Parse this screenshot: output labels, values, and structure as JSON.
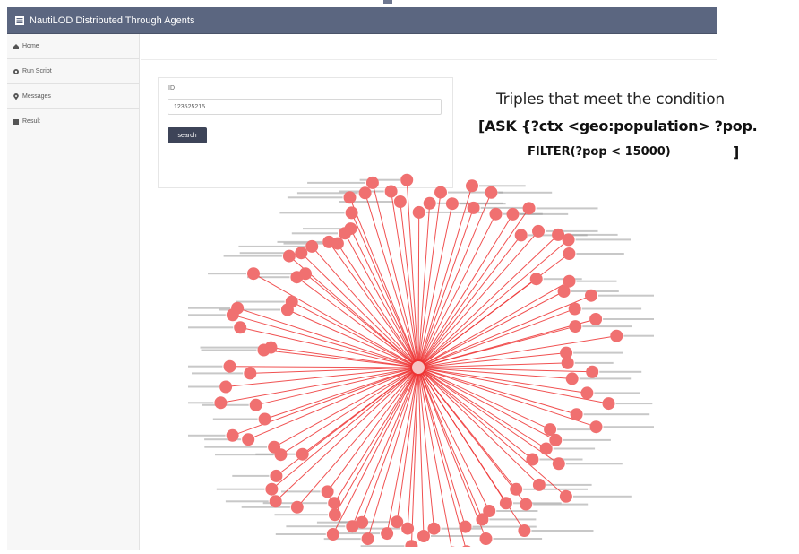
{
  "app": {
    "title": "NautiLOD Distributed Through Agents"
  },
  "sidebar": {
    "items": [
      {
        "label": "Home",
        "icon": "home-icon"
      },
      {
        "label": "Run Script",
        "icon": "gear-icon"
      },
      {
        "label": "Messages",
        "icon": "map-marker-icon"
      },
      {
        "label": "Result",
        "icon": "result-icon"
      }
    ]
  },
  "search": {
    "label": "ID",
    "value": "123525215",
    "button_label": "search"
  },
  "annotation": {
    "line1": "Triples that meet the condition",
    "line2": "[ASK {?ctx <geo:population> ?pop.",
    "line3": "FILTER(?pop < 15000)",
    "bracket": "]"
  },
  "graph": {
    "node_color": "#f07070",
    "edge_color": "#ee3333",
    "center_color": "#f6c4c4",
    "node_count": 100
  },
  "colors": {
    "topbar": "#5b6680",
    "sidebar_bg": "#f7f7f7",
    "button_bg": "#3d4458"
  }
}
